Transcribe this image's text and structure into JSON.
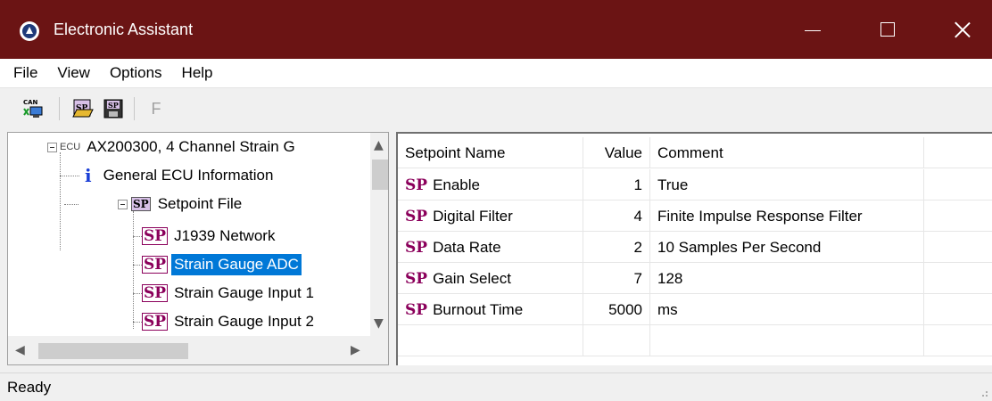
{
  "window": {
    "title": "Electronic Assistant",
    "titlebar_color": "#6b1414"
  },
  "menu": [
    "File",
    "View",
    "Options",
    "Help"
  ],
  "toolbar": {
    "can_icon_text": "CAN",
    "f_label": "F"
  },
  "tree": {
    "ecu_tag": "ECU",
    "ecu_label": "AX200300, 4 Channel Strain G",
    "general_info": "General ECU Information",
    "setpoint_file": "Setpoint File",
    "sp_icon_text": "SP",
    "children": [
      "J1939 Network",
      "Strain Gauge ADC",
      "Strain Gauge Input 1",
      "Strain Gauge Input 2"
    ],
    "selected": "Strain Gauge ADC"
  },
  "table": {
    "headers": [
      "Setpoint Name",
      "Value",
      "Comment"
    ],
    "sp_prefix": "SP",
    "rows": [
      {
        "name": "Enable",
        "value": "1",
        "comment": "True"
      },
      {
        "name": "Digital Filter",
        "value": "4",
        "comment": "Finite Impulse Response Filter"
      },
      {
        "name": "Data Rate",
        "value": "2",
        "comment": "10 Samples Per Second"
      },
      {
        "name": "Gain Select",
        "value": "7",
        "comment": "128"
      },
      {
        "name": "Burnout Time",
        "value": "5000",
        "comment": "ms"
      }
    ]
  },
  "status": {
    "text": "Ready"
  },
  "colors": {
    "sp_magenta": "#8b005b",
    "selection_blue": "#0078d7",
    "info_blue": "#1a3ed6"
  }
}
